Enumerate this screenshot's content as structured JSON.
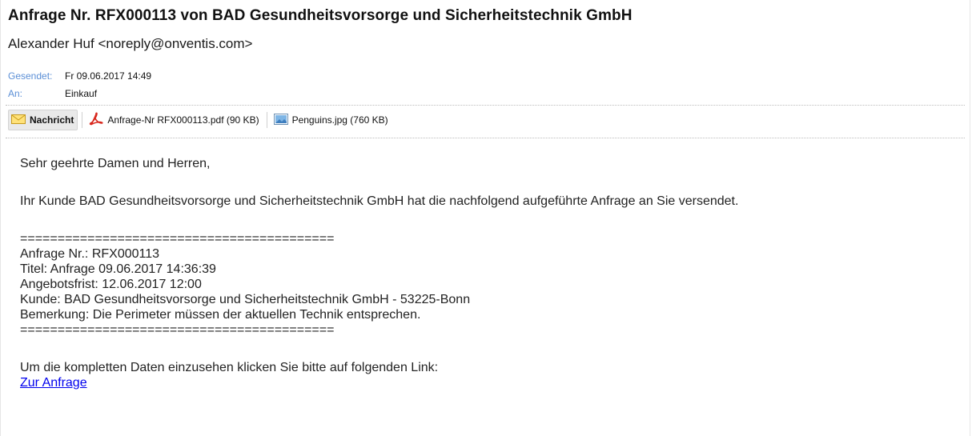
{
  "email": {
    "subject": "Anfrage Nr. RFX000113 von BAD Gesundheitsvorsorge und Sicherheitstechnik GmbH",
    "sender": "Alexander Huf <noreply@onventis.com>",
    "sent_label": "Gesendet:",
    "sent_value": "Fr 09.06.2017 14:49",
    "to_label": "An:",
    "to_value": "Einkauf"
  },
  "attachments": [
    {
      "label": "Nachricht",
      "icon": "envelope-icon"
    },
    {
      "label": "Anfrage-Nr RFX000113.pdf (90 KB)",
      "icon": "pdf-icon"
    },
    {
      "label": "Penguins.jpg (760 KB)",
      "icon": "image-icon"
    }
  ],
  "body": {
    "greeting": "Sehr geehrte Damen und Herren,",
    "intro": "Ihr Kunde BAD Gesundheitsvorsorge und Sicherheitstechnik GmbH hat die nachfolgend aufgeführte Anfrage an Sie versendet.",
    "separator": "==========================================",
    "lines": [
      "Anfrage Nr.: RFX000113",
      "Titel: Anfrage 09.06.2017 14:36:39",
      "Angebotsfrist: 12.06.2017 12:00",
      "Kunde: BAD Gesundheitsvorsorge und Sicherheitstechnik GmbH - 53225-Bonn",
      "Bemerkung: Die Perimeter müssen der aktuellen Technik entsprechen."
    ],
    "outro": "Um die kompletten Daten einzusehen klicken Sie bitte auf folgenden Link:",
    "link_label": "Zur Anfrage"
  },
  "colors": {
    "label_blue": "#5b8fd6",
    "link": "#0000ee"
  }
}
